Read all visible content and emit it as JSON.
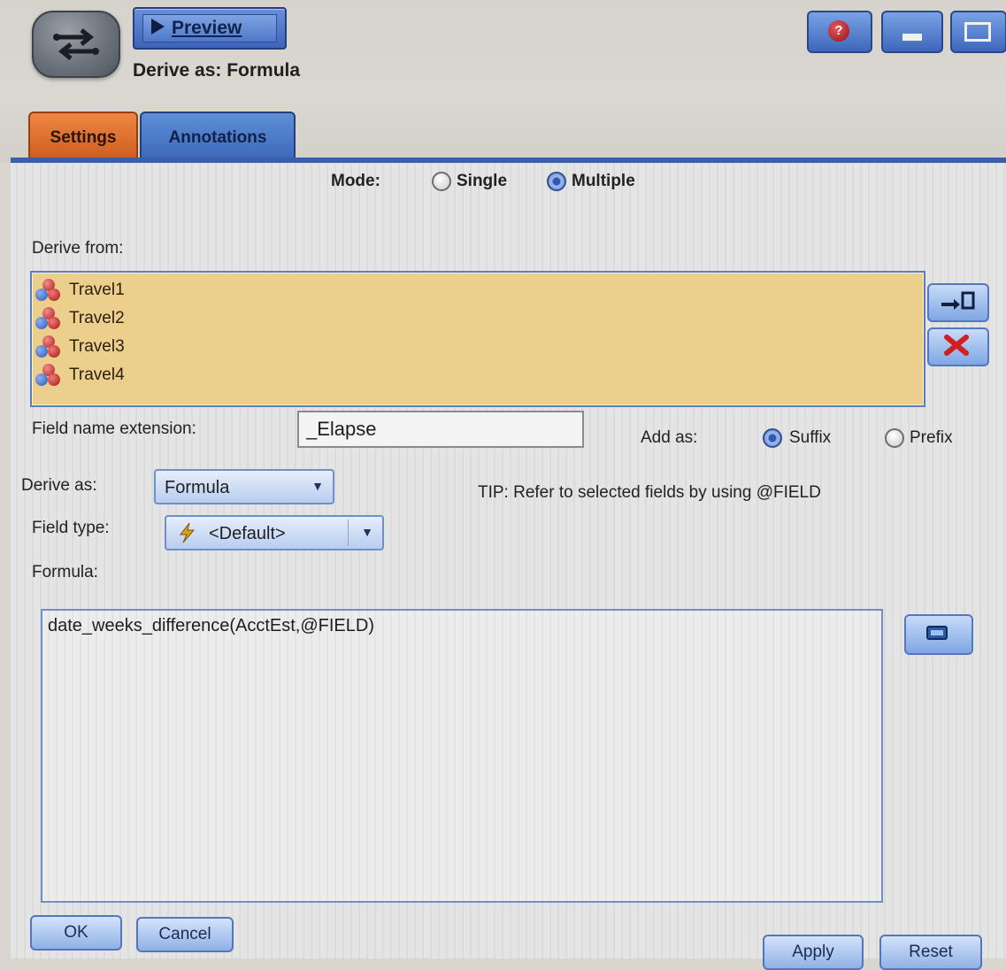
{
  "toolbar": {
    "preview_label": "Preview",
    "help_glyph": "?",
    "icons": {
      "node": "derive-node-icon",
      "preview": "play-icon",
      "help": "help-icon",
      "minimize": "minimize-icon",
      "maximize": "maximize-icon"
    }
  },
  "dialog": {
    "title": "Derive as: Formula"
  },
  "tabs": [
    {
      "label": "Settings",
      "active": true,
      "color": "#E07030"
    },
    {
      "label": "Annotations",
      "active": false,
      "color": "#4A78C8"
    }
  ],
  "mode": {
    "label": "Mode:",
    "options": [
      {
        "label": "Single",
        "selected": false
      },
      {
        "label": "Multiple",
        "selected": true
      }
    ]
  },
  "derive_from": {
    "label": "Derive from:",
    "fields": [
      "Travel1",
      "Travel2",
      "Travel3",
      "Travel4"
    ],
    "field_icon": "field-type-icon",
    "list_color": "#ECCF8C",
    "buttons": {
      "picker_icon": "field-picker-icon",
      "remove_icon": "delete-x-icon"
    }
  },
  "extension": {
    "label": "Field name extension:",
    "value": "_Elapse",
    "add_as_label": "Add as:",
    "options": [
      {
        "label": "Suffix",
        "selected": true
      },
      {
        "label": "Prefix",
        "selected": false
      }
    ]
  },
  "derive_as": {
    "label": "Derive as:",
    "value": "Formula",
    "tip": "TIP: Refer to selected fields by using @FIELD"
  },
  "field_type": {
    "label": "Field type:",
    "value": "<Default>",
    "icon": "lightning-icon"
  },
  "formula": {
    "label": "Formula:",
    "value": "date_weeks_difference(AcctEst,@FIELD)",
    "builder_icon": "expression-builder-icon"
  },
  "buttons": {
    "ok": "OK",
    "cancel": "Cancel",
    "apply": "Apply",
    "reset": "Reset"
  }
}
